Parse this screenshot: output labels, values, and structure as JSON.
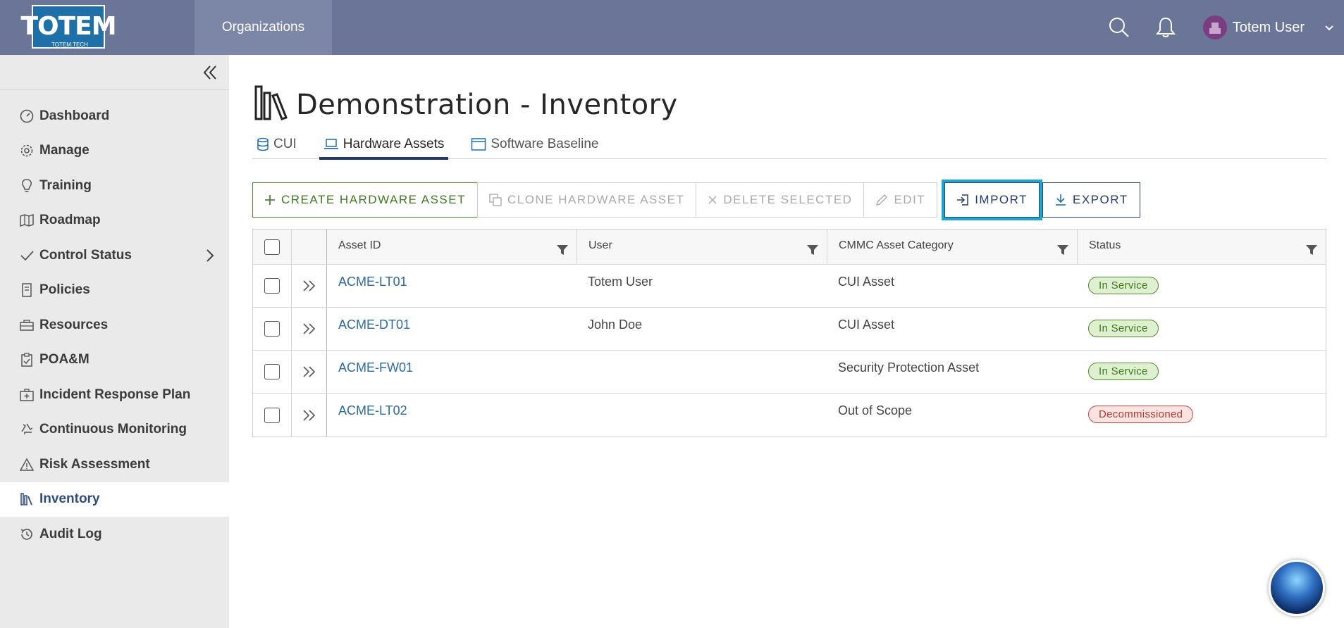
{
  "header": {
    "logo_text": "TOTEM",
    "logo_sub": "TOTEM.TECH",
    "org_tab": "Organizations",
    "user_name": "Totem User"
  },
  "sidebar": {
    "items": [
      {
        "label": "Dashboard",
        "icon": "gauge-icon"
      },
      {
        "label": "Manage",
        "icon": "gear-icon"
      },
      {
        "label": "Training",
        "icon": "lightbulb-icon"
      },
      {
        "label": "Roadmap",
        "icon": "map-icon"
      },
      {
        "label": "Control Status",
        "icon": "check-icon"
      },
      {
        "label": "Policies",
        "icon": "document-icon"
      },
      {
        "label": "Resources",
        "icon": "toolbox-icon"
      },
      {
        "label": "POA&M",
        "icon": "clipboard-icon"
      },
      {
        "label": "Incident Response Plan",
        "icon": "first-aid-icon"
      },
      {
        "label": "Continuous Monitoring",
        "icon": "recycle-icon"
      },
      {
        "label": "Risk Assessment",
        "icon": "warning-icon"
      },
      {
        "label": "Inventory",
        "icon": "books-icon",
        "active": true
      },
      {
        "label": "Audit Log",
        "icon": "history-icon"
      }
    ]
  },
  "page": {
    "title": "Demonstration - Inventory"
  },
  "tabs": [
    {
      "label": "CUI",
      "icon": "database-icon"
    },
    {
      "label": "Hardware Assets",
      "icon": "laptop-icon",
      "active": true
    },
    {
      "label": "Software Baseline",
      "icon": "window-icon"
    }
  ],
  "toolbar": {
    "create": "Create Hardware Asset",
    "clone": "Clone Hardware Asset",
    "delete": "Delete Selected",
    "edit": "Edit",
    "import": "Import",
    "export": "Export"
  },
  "table": {
    "columns": [
      "Asset ID",
      "User",
      "CMMC Asset Category",
      "Status"
    ],
    "rows": [
      {
        "asset_id": "ACME-LT01",
        "user": "Totem User",
        "category": "CUI Asset",
        "status": "In Service",
        "status_type": "ok"
      },
      {
        "asset_id": "ACME-DT01",
        "user": "John Doe",
        "category": "CUI Asset",
        "status": "In Service",
        "status_type": "ok"
      },
      {
        "asset_id": "ACME-FW01",
        "user": "",
        "category": "Security Protection Asset",
        "status": "In Service",
        "status_type": "ok"
      },
      {
        "asset_id": "ACME-LT02",
        "user": "",
        "category": "Out of Scope",
        "status": "Decommissioned",
        "status_type": "bad"
      }
    ]
  },
  "colors": {
    "topbar": "#6a7598",
    "accent_green": "#4d8a2a",
    "accent_navy": "#223a6e",
    "highlight": "#1ea5c9"
  }
}
